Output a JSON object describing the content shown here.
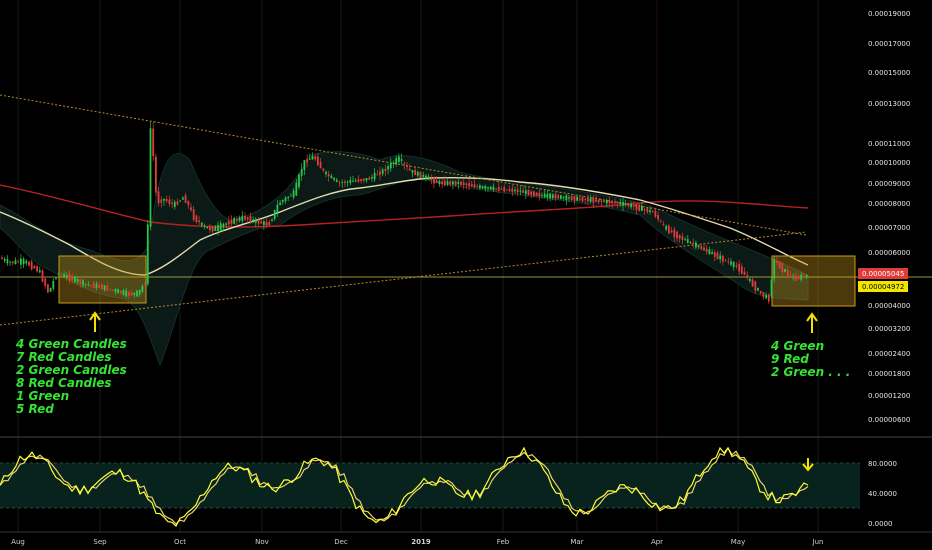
{
  "chart_data": {
    "type": "candlestick",
    "price_scale": {
      "ticks": [
        "0.00019000",
        "0.00017000",
        "0.00015000",
        "0.00013000",
        "0.00011000",
        "0.00010000",
        "0.00009000",
        "0.00008000",
        "0.00007000",
        "0.00006000",
        "0.00004000",
        "0.00003200",
        "0.00002400",
        "0.00001800",
        "0.00001200",
        "0.00000600"
      ],
      "current_price_red": "0.00005045",
      "current_price_yellow": "0.00004972"
    },
    "time_axis": [
      "Aug",
      "Sep",
      "Oct",
      "Nov",
      "Dec",
      "2019",
      "Feb",
      "Mar",
      "Apr",
      "May",
      "Jun"
    ],
    "oscillator_scale": [
      "80.0000",
      "40.0000",
      "0.0000"
    ],
    "annotations": {
      "left": [
        "4 Green Candles",
        "7 Red Candles",
        "2 Green Candles",
        "8 Red Candles",
        "1 Green",
        "5 Red"
      ],
      "right": [
        "4 Green",
        "9 Red",
        "2 Green . . ."
      ]
    },
    "price_path": [
      [
        0,
        5.8e-05
      ],
      [
        10,
        5.6e-05
      ],
      [
        25,
        5.65e-05
      ],
      [
        40,
        5.3e-05
      ],
      [
        50,
        4.45e-05
      ],
      [
        58,
        5.2e-05
      ],
      [
        70,
        5.05e-05
      ],
      [
        85,
        4.8e-05
      ],
      [
        100,
        4.7e-05
      ],
      [
        115,
        4.55e-05
      ],
      [
        130,
        4.4e-05
      ],
      [
        140,
        4.45e-05
      ],
      [
        148,
        5e-05
      ],
      [
        152,
        0.00012
      ],
      [
        158,
        8e-05
      ],
      [
        165,
        8.2e-05
      ],
      [
        175,
        7.9e-05
      ],
      [
        185,
        8.3e-05
      ],
      [
        195,
        7.4e-05
      ],
      [
        205,
        7e-05
      ],
      [
        215,
        6.9e-05
      ],
      [
        230,
        7.2e-05
      ],
      [
        245,
        7.4e-05
      ],
      [
        260,
        7.2e-05
      ],
      [
        270,
        7.1e-05
      ],
      [
        280,
        8e-05
      ],
      [
        295,
        8.5e-05
      ],
      [
        305,
        0.0001
      ],
      [
        315,
        0.000103
      ],
      [
        325,
        9.5e-05
      ],
      [
        340,
        9e-05
      ],
      [
        355,
        9.1e-05
      ],
      [
        370,
        9.2e-05
      ],
      [
        385,
        9.6e-05
      ],
      [
        400,
        0.000102
      ],
      [
        410,
        9.6e-05
      ],
      [
        425,
        9.3e-05
      ],
      [
        440,
        9e-05
      ],
      [
        460,
        9e-05
      ],
      [
        480,
        8.8e-05
      ],
      [
        500,
        8.7e-05
      ],
      [
        520,
        8.6e-05
      ],
      [
        540,
        8.4e-05
      ],
      [
        560,
        8.3e-05
      ],
      [
        580,
        8.2e-05
      ],
      [
        600,
        8.1e-05
      ],
      [
        620,
        8e-05
      ],
      [
        640,
        7.8e-05
      ],
      [
        655,
        7.6e-05
      ],
      [
        665,
        7e-05
      ],
      [
        680,
        6.6e-05
      ],
      [
        700,
        6.2e-05
      ],
      [
        720,
        5.8e-05
      ],
      [
        740,
        5.4e-05
      ],
      [
        760,
        4.5e-05
      ],
      [
        770,
        4.2e-05
      ],
      [
        775,
        5.7e-05
      ],
      [
        785,
        5.3e-05
      ],
      [
        795,
        5e-05
      ],
      [
        808,
        5.1e-05
      ]
    ]
  }
}
